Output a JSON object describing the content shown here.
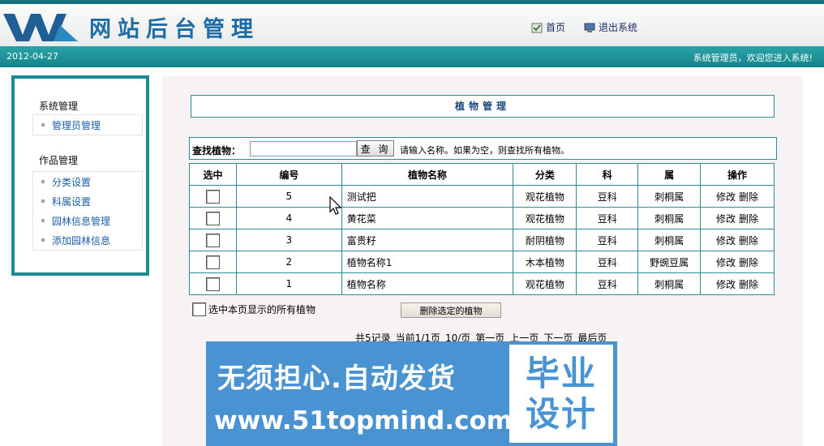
{
  "header": {
    "site_title": "网站后台管理",
    "home_link": "首页",
    "logout_link": "退出系统"
  },
  "statusbar": {
    "date": "2012-04-27",
    "welcome": "系统管理员，欢迎您进入系统!"
  },
  "sidebar": {
    "groups": [
      {
        "title": "系统管理",
        "items": [
          "管理员管理"
        ]
      },
      {
        "title": "作品管理",
        "items": [
          "分类设置",
          "科属设置",
          "园林信息管理",
          "添加园林信息"
        ]
      }
    ]
  },
  "panel": {
    "title": "植物管理",
    "search_label": "查找植物：",
    "search_value": "",
    "search_button": "查 询",
    "search_hint": "请输入名称。如果为空，则查找所有植物。"
  },
  "table": {
    "headers": [
      "选中",
      "编号",
      "植物名称",
      "分类",
      "科",
      "属",
      "操作"
    ],
    "rows": [
      {
        "id": "5",
        "name": "测试把",
        "category": "观花植物",
        "family": "豆科",
        "genus": "刺桐属"
      },
      {
        "id": "4",
        "name": "黄花菜",
        "category": "观花植物",
        "family": "豆科",
        "genus": "刺桐属"
      },
      {
        "id": "3",
        "name": "富贵籽",
        "category": "耐阴植物",
        "family": "豆科",
        "genus": "刺桐属"
      },
      {
        "id": "2",
        "name": "植物名称1",
        "category": "木本植物",
        "family": "豆科",
        "genus": "野豌豆属"
      },
      {
        "id": "1",
        "name": "植物名称",
        "category": "观花植物",
        "family": "豆科",
        "genus": "刺桐属"
      }
    ],
    "edit_label": "修改",
    "delete_label": "删除"
  },
  "bulk": {
    "select_all_label": "选中本页显示的所有植物",
    "delete_selected_button": "删除选定的植物"
  },
  "pagination": {
    "total": "共5记录",
    "current": "当前1/1页",
    "page_size": "10/页",
    "first": "第一页",
    "prev": "上一页",
    "next": "下一页",
    "last": "最后页"
  },
  "watermark": {
    "line1": "无须担心.自动发货",
    "line2": "www.51topmind.com",
    "badge_line1": "毕业",
    "badge_line2": "设计"
  },
  "colors": {
    "teal": "#13848a",
    "border": "#2b8e96",
    "title_blue": "#1f6ca4",
    "link_blue": "#1a5fa8",
    "watermark_blue": "#4a93d2"
  }
}
